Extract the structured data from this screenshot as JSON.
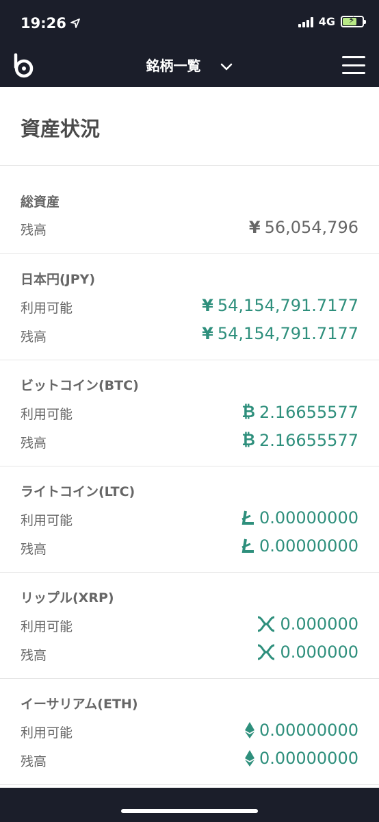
{
  "status": {
    "time": "19:26",
    "network": "4G"
  },
  "nav": {
    "title": "銘柄一覧"
  },
  "page": {
    "title": "資産状況"
  },
  "total": {
    "title": "総資産",
    "balance_label": "残高",
    "balance_symbol": "¥",
    "balance_value": "56,054,796"
  },
  "jpy": {
    "title": "日本円(JPY)",
    "available_label": "利用可能",
    "available_symbol": "¥",
    "available_value": "54,154,791.7177",
    "balance_label": "残高",
    "balance_symbol": "¥",
    "balance_value": "54,154,791.7177"
  },
  "btc": {
    "title": "ビットコイン(BTC)",
    "available_label": "利用可能",
    "available_symbol": "₿",
    "available_value": "2.16655577",
    "balance_label": "残高",
    "balance_symbol": "₿",
    "balance_value": "2.16655577"
  },
  "ltc": {
    "title": "ライトコイン(LTC)",
    "available_label": "利用可能",
    "available_value": "0.00000000",
    "balance_label": "残高",
    "balance_value": "0.00000000"
  },
  "xrp": {
    "title": "リップル(XRP)",
    "available_label": "利用可能",
    "available_value": "0.000000",
    "balance_label": "残高",
    "balance_value": "0.000000"
  },
  "eth": {
    "title": "イーサリアム(ETH)",
    "available_label": "利用可能",
    "available_value": "0.00000000",
    "balance_label": "残高",
    "balance_value": "0.00000000"
  },
  "colors": {
    "header_bg": "#1b1e2a",
    "accent_green": "#2e8f7c",
    "text_gray": "#666666",
    "divider": "#e6e6e6"
  },
  "icons": {
    "location": "location-arrow-icon",
    "signal": "signal-icon",
    "battery": "battery-charging-icon",
    "logo": "bitbank-logo-icon",
    "dropdown": "chevron-down-icon",
    "menu": "hamburger-menu-icon",
    "litecoin": "litecoin-icon",
    "ripple": "ripple-icon",
    "ethereum": "ethereum-icon"
  }
}
